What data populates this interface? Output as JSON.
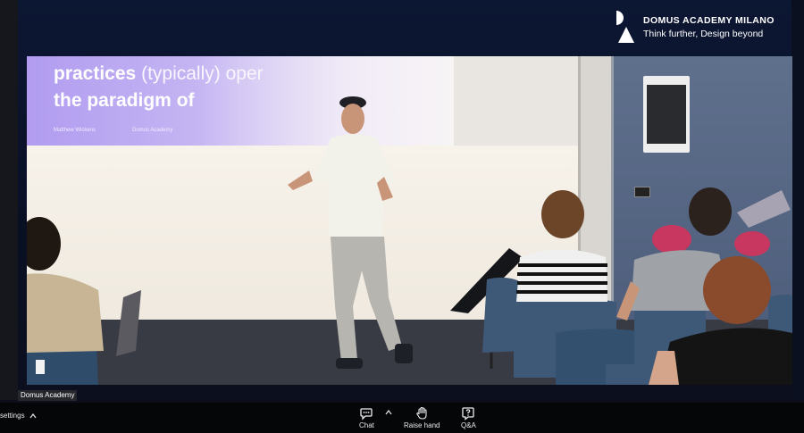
{
  "branding": {
    "name": "DOMUS ACADEMY MILANO",
    "tagline": "Think further, Design beyond"
  },
  "slide": {
    "line1_bold": "practices",
    "line1_light": "(typically) oper",
    "line2": "the paradigm of",
    "credit_left": "Matthew Wickens",
    "credit_right": "Domus Academy"
  },
  "video_label": "Domus Academy",
  "toolbar": {
    "settings_label": "settings",
    "chat_label": "Chat",
    "raise_hand_label": "Raise hand",
    "qa_label": "Q&A"
  },
  "colors": {
    "slide_accent": "#b19cf0",
    "toolbar_bg": "#050608",
    "chair_blue": "#3e5877"
  },
  "icons": [
    "domus-logo-icon",
    "chevron-up-icon",
    "chat-icon",
    "raise-hand-icon",
    "qa-icon"
  ]
}
